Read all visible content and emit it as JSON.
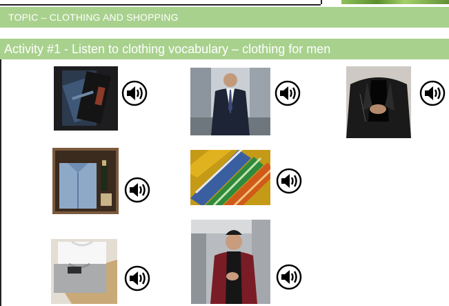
{
  "topic": {
    "title": "TOPIC – CLOTHING  AND SHOPPING"
  },
  "activity": {
    "title": "Activity #1 - Listen to clothing vocabulary – clothing for men"
  },
  "colors": {
    "header_green": "#a9d18e",
    "header_text": "#ffffff"
  },
  "items": [
    {
      "picture": "folded-jeans",
      "audio_icon": "speaker-icon"
    },
    {
      "picture": "man-in-suit",
      "audio_icon": "speaker-icon"
    },
    {
      "picture": "leather-jacket",
      "audio_icon": "speaker-icon"
    },
    {
      "picture": "shirt-in-suitcase",
      "audio_icon": "speaker-icon"
    },
    {
      "picture": "striped-ties",
      "audio_icon": "speaker-icon"
    },
    {
      "picture": "folded-t-shirts",
      "audio_icon": "speaker-icon"
    },
    {
      "picture": "man-in-blazer",
      "audio_icon": "speaker-icon"
    }
  ]
}
